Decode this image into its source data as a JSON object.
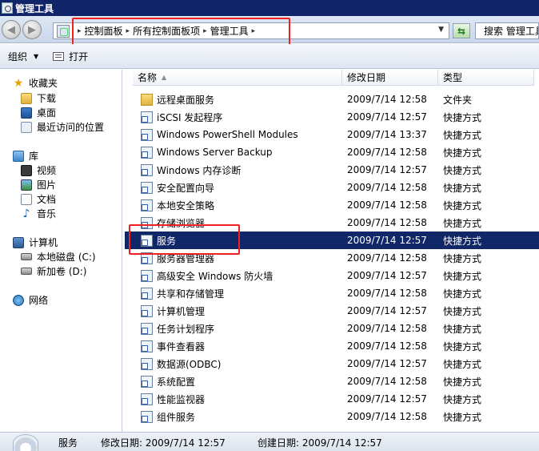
{
  "window": {
    "title": "管理工具"
  },
  "address_bar": {
    "breadcrumbs": [
      "控制面板",
      "所有控制面板项",
      "管理工具"
    ]
  },
  "search": {
    "placeholder": "搜索 管理工具"
  },
  "toolbar": {
    "organize_label": "组织",
    "open_label": "打开"
  },
  "nav_pane": {
    "favorites": {
      "label": "收藏夹",
      "items": [
        "下载",
        "桌面",
        "最近访问的位置"
      ]
    },
    "libraries": {
      "label": "库",
      "items": [
        "视频",
        "图片",
        "文档",
        "音乐"
      ]
    },
    "computer": {
      "label": "计算机",
      "items": [
        "本地磁盘 (C:)",
        "新加卷 (D:)"
      ]
    },
    "network": {
      "label": "网络"
    }
  },
  "columns": {
    "name": "名称",
    "modified": "修改日期",
    "type": "类型"
  },
  "files": [
    {
      "name": "远程桌面服务",
      "modified": "2009/7/14 12:58",
      "type": "文件夹",
      "icon": "folder-icon"
    },
    {
      "name": "iSCSI 发起程序",
      "modified": "2009/7/14 12:57",
      "type": "快捷方式",
      "icon": "shortcut-icon"
    },
    {
      "name": "Windows PowerShell Modules",
      "modified": "2009/7/14 13:37",
      "type": "快捷方式",
      "icon": "shortcut-icon"
    },
    {
      "name": "Windows Server Backup",
      "modified": "2009/7/14 12:58",
      "type": "快捷方式",
      "icon": "shortcut-icon"
    },
    {
      "name": "Windows 内存诊断",
      "modified": "2009/7/14 12:57",
      "type": "快捷方式",
      "icon": "shortcut-icon"
    },
    {
      "name": "安全配置向导",
      "modified": "2009/7/14 12:58",
      "type": "快捷方式",
      "icon": "shortcut-icon"
    },
    {
      "name": "本地安全策略",
      "modified": "2009/7/14 12:58",
      "type": "快捷方式",
      "icon": "shortcut-icon"
    },
    {
      "name": "存储浏览器",
      "modified": "2009/7/14 12:58",
      "type": "快捷方式",
      "icon": "shortcut-icon"
    },
    {
      "name": "服务",
      "modified": "2009/7/14 12:57",
      "type": "快捷方式",
      "icon": "shortcut-icon",
      "selected": true
    },
    {
      "name": "服务器管理器",
      "modified": "2009/7/14 12:58",
      "type": "快捷方式",
      "icon": "shortcut-icon"
    },
    {
      "name": "高级安全 Windows 防火墙",
      "modified": "2009/7/14 12:57",
      "type": "快捷方式",
      "icon": "shortcut-icon"
    },
    {
      "name": "共享和存储管理",
      "modified": "2009/7/14 12:58",
      "type": "快捷方式",
      "icon": "shortcut-icon"
    },
    {
      "name": "计算机管理",
      "modified": "2009/7/14 12:57",
      "type": "快捷方式",
      "icon": "shortcut-icon"
    },
    {
      "name": "任务计划程序",
      "modified": "2009/7/14 12:58",
      "type": "快捷方式",
      "icon": "shortcut-icon"
    },
    {
      "name": "事件查看器",
      "modified": "2009/7/14 12:58",
      "type": "快捷方式",
      "icon": "shortcut-icon"
    },
    {
      "name": "数据源(ODBC)",
      "modified": "2009/7/14 12:57",
      "type": "快捷方式",
      "icon": "shortcut-icon"
    },
    {
      "name": "系统配置",
      "modified": "2009/7/14 12:58",
      "type": "快捷方式",
      "icon": "shortcut-icon"
    },
    {
      "name": "性能监视器",
      "modified": "2009/7/14 12:57",
      "type": "快捷方式",
      "icon": "shortcut-icon"
    },
    {
      "name": "组件服务",
      "modified": "2009/7/14 12:58",
      "type": "快捷方式",
      "icon": "shortcut-icon"
    }
  ],
  "status_bar": {
    "item_name": "服务",
    "modified": "修改日期: 2009/7/14 12:57",
    "created": "创建日期: 2009/7/14 12:57"
  },
  "colors": {
    "selection": "#102868",
    "highlight_box": "#f02020",
    "titlebar": "#10246a"
  }
}
